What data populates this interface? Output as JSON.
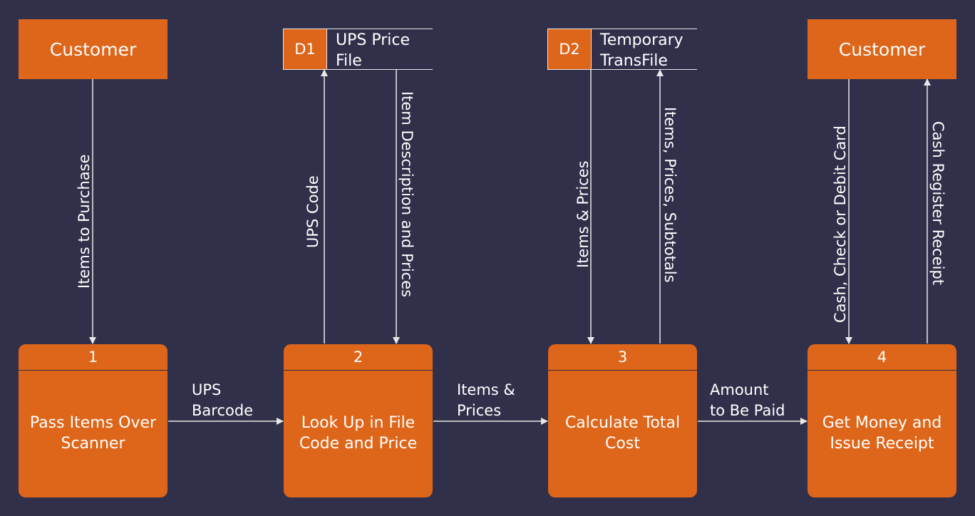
{
  "colors": {
    "background": "#30304a",
    "accent": "#de661a",
    "line": "#e8e8e8",
    "text": "#ffffff"
  },
  "external_entities": [
    {
      "id": "customer-left",
      "label": "Customer"
    },
    {
      "id": "customer-right",
      "label": "Customer"
    }
  ],
  "data_stores": [
    {
      "id": "D1",
      "label": "UPS Price\nFile"
    },
    {
      "id": "D2",
      "label": "Temporary\nTransFile"
    }
  ],
  "processes": [
    {
      "number": "1",
      "label": "Pass Items Over\nScanner"
    },
    {
      "number": "2",
      "label": "Look Up in File\nCode and Price"
    },
    {
      "number": "3",
      "label": "Calculate Total\nCost"
    },
    {
      "number": "4",
      "label": "Get Money and\nIssue Receipt"
    }
  ],
  "flows": {
    "items_to_purchase": "Items to Purchase",
    "ups_code": "UPS Code",
    "item_description_prices": "Item Description and Prices",
    "items_prices_down": "Items & Prices",
    "items_prices_subtotals": "Items, Prices, Subtotals",
    "cash_check_debit": "Cash, Check or Debit Card",
    "cash_register_receipt": "Cash Register Receipt",
    "ups_barcode": "UPS\nBarcode",
    "items_prices_right": "Items &\nPrices",
    "amount_to_be_paid": "Amount\nto Be Paid"
  }
}
